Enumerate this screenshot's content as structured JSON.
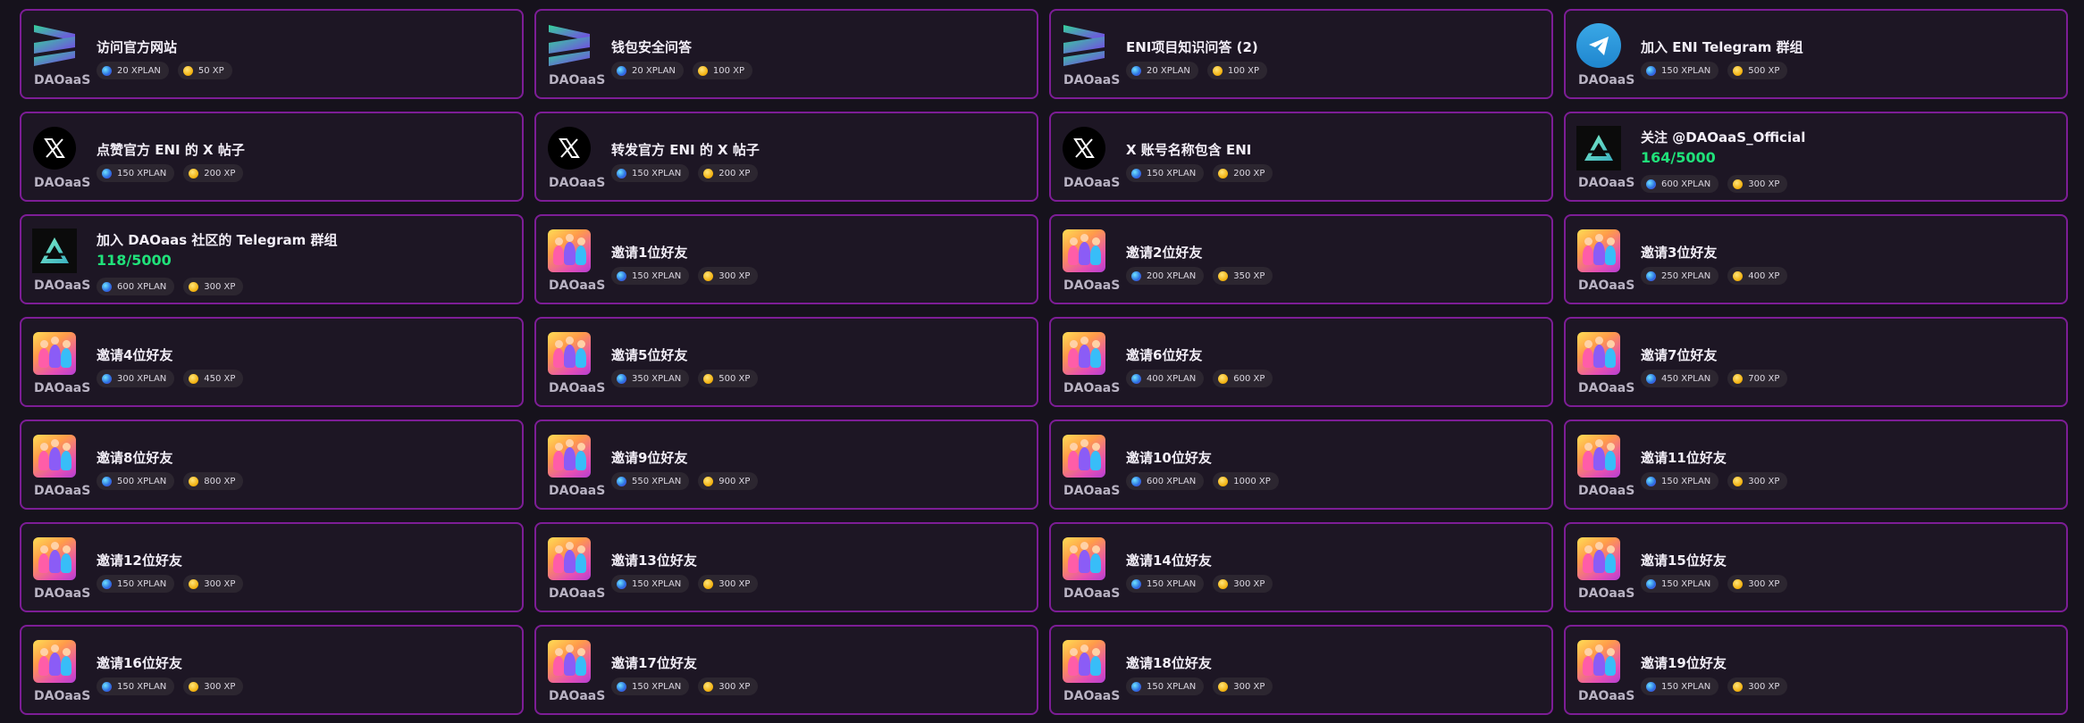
{
  "brand": "DAOaaS",
  "rows": [
    [
      {
        "logo": "stack-icon",
        "title": "访问官方网站",
        "xplan": "20 XPLAN",
        "xp": "50 XP"
      },
      {
        "logo": "stack-icon",
        "title": "钱包安全问答",
        "xplan": "20 XPLAN",
        "xp": "100 XP"
      },
      {
        "logo": "stack-icon",
        "title": "ENI项目知识问答 (2)",
        "xplan": "20 XPLAN",
        "xp": "100 XP"
      },
      {
        "logo": "telegram-icon",
        "title": "加入 ENI Telegram 群组",
        "xplan": "150 XPLAN",
        "xp": "500 XP"
      }
    ],
    [
      {
        "logo": "x-icon",
        "title": "点赞官方 ENI 的 X 帖子",
        "xplan": "150 XPLAN",
        "xp": "200 XP"
      },
      {
        "logo": "x-icon",
        "title": "转发官方 ENI 的 X 帖子",
        "xplan": "150 XPLAN",
        "xp": "200 XP"
      },
      {
        "logo": "x-icon",
        "title": "X 账号名称包含 ENI",
        "xplan": "150 XPLAN",
        "xp": "200 XP"
      },
      {
        "logo": "daoaas-icon",
        "title": "关注 @DAOaaS_Official",
        "progress": "164/5000",
        "xplan": "600 XPLAN",
        "xp": "300 XP"
      }
    ],
    [
      {
        "logo": "daoaas-icon",
        "title": "加入 DAOaas 社区的 Telegram 群组",
        "progress": "118/5000",
        "xplan": "600 XPLAN",
        "xp": "300 XP"
      },
      {
        "logo": "friends-icon",
        "title": "邀请1位好友",
        "xplan": "150 XPLAN",
        "xp": "300 XP"
      },
      {
        "logo": "friends-icon",
        "title": "邀请2位好友",
        "xplan": "200 XPLAN",
        "xp": "350 XP"
      },
      {
        "logo": "friends-icon",
        "title": "邀请3位好友",
        "xplan": "250 XPLAN",
        "xp": "400 XP"
      }
    ],
    [
      {
        "logo": "friends-icon",
        "title": "邀请4位好友",
        "xplan": "300 XPLAN",
        "xp": "450 XP"
      },
      {
        "logo": "friends-icon",
        "title": "邀请5位好友",
        "xplan": "350 XPLAN",
        "xp": "500 XP"
      },
      {
        "logo": "friends-icon",
        "title": "邀请6位好友",
        "xplan": "400 XPLAN",
        "xp": "600 XP"
      },
      {
        "logo": "friends-icon",
        "title": "邀请7位好友",
        "xplan": "450 XPLAN",
        "xp": "700 XP"
      }
    ],
    [
      {
        "logo": "friends-icon",
        "title": "邀请8位好友",
        "xplan": "500 XPLAN",
        "xp": "800 XP"
      },
      {
        "logo": "friends-icon",
        "title": "邀请9位好友",
        "xplan": "550 XPLAN",
        "xp": "900 XP"
      },
      {
        "logo": "friends-icon",
        "title": "邀请10位好友",
        "xplan": "600 XPLAN",
        "xp": "1000 XP"
      },
      {
        "logo": "friends-icon",
        "title": "邀请11位好友",
        "xplan": "150 XPLAN",
        "xp": "300 XP"
      }
    ],
    [
      {
        "logo": "friends-icon",
        "title": "邀请12位好友",
        "xplan": "150 XPLAN",
        "xp": "300 XP"
      },
      {
        "logo": "friends-icon",
        "title": "邀请13位好友",
        "xplan": "150 XPLAN",
        "xp": "300 XP"
      },
      {
        "logo": "friends-icon",
        "title": "邀请14位好友",
        "xplan": "150 XPLAN",
        "xp": "300 XP"
      },
      {
        "logo": "friends-icon",
        "title": "邀请15位好友",
        "xplan": "150 XPLAN",
        "xp": "300 XP"
      }
    ],
    [
      {
        "logo": "friends-icon",
        "title": "邀请16位好友",
        "xplan": "150 XPLAN",
        "xp": "300 XP"
      },
      {
        "logo": "friends-icon",
        "title": "邀请17位好友",
        "xplan": "150 XPLAN",
        "xp": "300 XP"
      },
      {
        "logo": "friends-icon",
        "title": "邀请18位好友",
        "xplan": "150 XPLAN",
        "xp": "300 XP"
      },
      {
        "logo": "friends-icon",
        "title": "邀请19位好友",
        "xplan": "150 XPLAN",
        "xp": "300 XP"
      }
    ]
  ],
  "colors": {
    "border": "#7d1d96",
    "card_bg": "#1d1624",
    "page_bg": "#16121c",
    "progress": "#20e27a"
  }
}
